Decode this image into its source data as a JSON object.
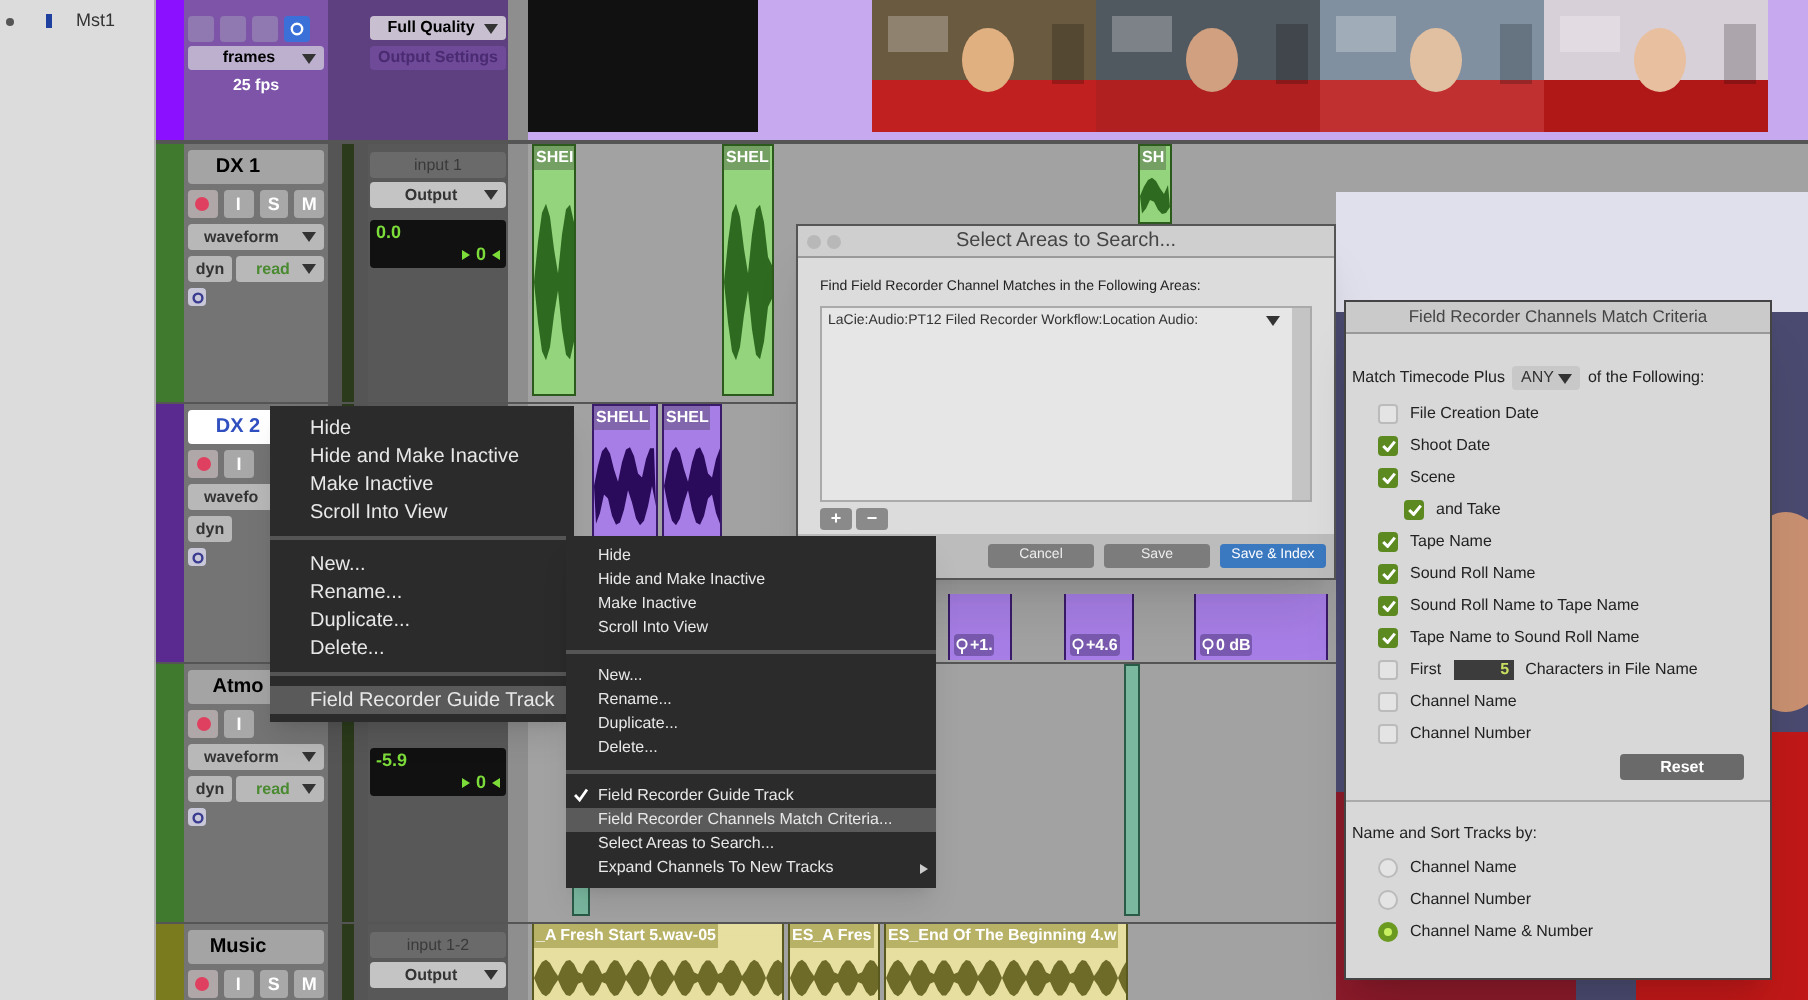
{
  "track_list": {
    "items": [
      "Mst1"
    ]
  },
  "video_track": {
    "rate_menu": "frames",
    "fps": "25 fps",
    "quality": "Full Quality",
    "output_settings": "Output Settings"
  },
  "tracks": [
    {
      "name": "DX 1",
      "color": "#3f7a2e",
      "selected": false,
      "buttons": [
        "I",
        "S",
        "M"
      ],
      "view": "waveform",
      "dyn": "dyn",
      "automation": "read",
      "input": "input 1",
      "output": "Output",
      "vol": "0.0",
      "pan": "0",
      "clips": [
        {
          "kind": "audio",
          "name": "SHEI"
        },
        {
          "kind": "audio",
          "name": "SHEL"
        },
        {
          "kind": "audio",
          "name": "SH"
        }
      ]
    },
    {
      "name": "DX 2",
      "color": "#5a2a90",
      "selected": true,
      "buttons": [
        "I"
      ],
      "view": "wavefo",
      "dyn": "dyn",
      "clips": [
        {
          "kind": "audio",
          "name": "SHELL"
        },
        {
          "kind": "audio",
          "name": "SHEL"
        },
        {
          "kind": "gain",
          "name": "+1."
        },
        {
          "kind": "gain",
          "name": "+4.6"
        },
        {
          "kind": "gain",
          "name": "0 dB"
        }
      ]
    },
    {
      "name": "Atmo",
      "color": "#3f7a2e",
      "selected": false,
      "buttons": [
        "I"
      ],
      "view": "waveform",
      "dyn": "dyn",
      "automation": "read",
      "vol": "-5.9",
      "pan": "0",
      "clips": [
        {
          "kind": "thin"
        },
        {
          "kind": "thin"
        }
      ]
    },
    {
      "name": "Music",
      "color": "#7a7a1e",
      "selected": false,
      "buttons": [
        "I",
        "S",
        "M"
      ],
      "input": "input 1-2",
      "output": "Output",
      "clips": [
        {
          "kind": "music",
          "name": "_A Fresh Start 5.wav-05"
        },
        {
          "kind": "music",
          "name": "ES_A Fres"
        },
        {
          "kind": "music",
          "name": "ES_End Of The Beginning 4.w"
        }
      ]
    }
  ],
  "context_menu": {
    "groups": [
      [
        {
          "label": "Hide",
          "selected": false
        },
        {
          "label": "Hide and Make Inactive",
          "selected": false
        },
        {
          "label": "Make Inactive",
          "selected": false
        },
        {
          "label": "Scroll Into View",
          "selected": false
        }
      ],
      [
        {
          "label": "New...",
          "selected": false
        },
        {
          "label": "Rename...",
          "selected": false
        },
        {
          "label": "Duplicate...",
          "selected": false
        },
        {
          "label": "Delete...",
          "selected": false
        }
      ],
      [
        {
          "label": "Field Recorder Guide Track",
          "selected": true
        }
      ]
    ]
  },
  "submenu": {
    "groups": [
      [
        {
          "label": "Hide",
          "selected": false,
          "checked": false
        },
        {
          "label": "Hide and Make Inactive",
          "selected": false,
          "checked": false
        },
        {
          "label": "Make Inactive",
          "selected": false,
          "checked": false
        },
        {
          "label": "Scroll Into View",
          "selected": false,
          "checked": false
        }
      ],
      [
        {
          "label": "New...",
          "selected": false,
          "checked": false
        },
        {
          "label": "Rename...",
          "selected": false,
          "checked": false
        },
        {
          "label": "Duplicate...",
          "selected": false,
          "checked": false
        },
        {
          "label": "Delete...",
          "selected": false,
          "checked": false
        }
      ],
      [
        {
          "label": "Field Recorder Guide Track",
          "selected": false,
          "checked": true
        },
        {
          "label": "Field Recorder Channels Match Criteria...",
          "selected": true,
          "checked": false
        },
        {
          "label": "Select Areas to Search...",
          "selected": false,
          "checked": false
        },
        {
          "label": "Expand Channels To New Tracks",
          "selected": false,
          "checked": false,
          "has_submenu": true
        }
      ]
    ]
  },
  "areas_dialog": {
    "title": "Select Areas to Search...",
    "prompt": "Find Field Recorder Channel Matches in the Following Areas:",
    "paths": [
      "LaCie:Audio:PT12 Filed Recorder Workflow:Location Audio:"
    ],
    "add_remove": [
      "+",
      "−"
    ],
    "buttons": [
      {
        "label": "Cancel",
        "kind": "normal"
      },
      {
        "label": "Save",
        "kind": "normal"
      },
      {
        "label": "Save & Index",
        "kind": "default"
      }
    ]
  },
  "criteria_window": {
    "title": "Field Recorder Channels Match Criteria",
    "match_prefix": "Match Timecode Plus",
    "match_mode": "ANY",
    "match_suffix": "of the Following:",
    "criteria": [
      {
        "kind": "checkbox",
        "label": "File Creation Date",
        "checked": false
      },
      {
        "kind": "checkbox",
        "label": "Shoot Date",
        "checked": true
      },
      {
        "kind": "checkbox",
        "label": "Scene",
        "checked": true,
        "children": [
          {
            "kind": "checkbox",
            "label": "and Take",
            "checked": true
          }
        ]
      },
      {
        "kind": "checkbox",
        "label": "Tape Name",
        "checked": true
      },
      {
        "kind": "checkbox",
        "label": "Sound Roll Name",
        "checked": true
      },
      {
        "kind": "checkbox",
        "label": "Sound Roll Name to Tape Name",
        "checked": true
      },
      {
        "kind": "checkbox",
        "label": "Tape Name to Sound Roll Name",
        "checked": true
      },
      {
        "kind": "chars",
        "prefix": "First",
        "value": "5",
        "label": "Characters in File Name",
        "checked": false
      },
      {
        "kind": "checkbox",
        "label": "Channel Name",
        "checked": false
      },
      {
        "kind": "checkbox",
        "label": "Channel Number",
        "checked": false
      }
    ],
    "reset": "Reset",
    "sort_label": "Name and Sort Tracks by:",
    "sort_options": [
      {
        "label": "Channel Name",
        "selected": false
      },
      {
        "label": "Channel Number",
        "selected": false
      },
      {
        "label": "Channel Name & Number",
        "selected": true
      }
    ]
  }
}
